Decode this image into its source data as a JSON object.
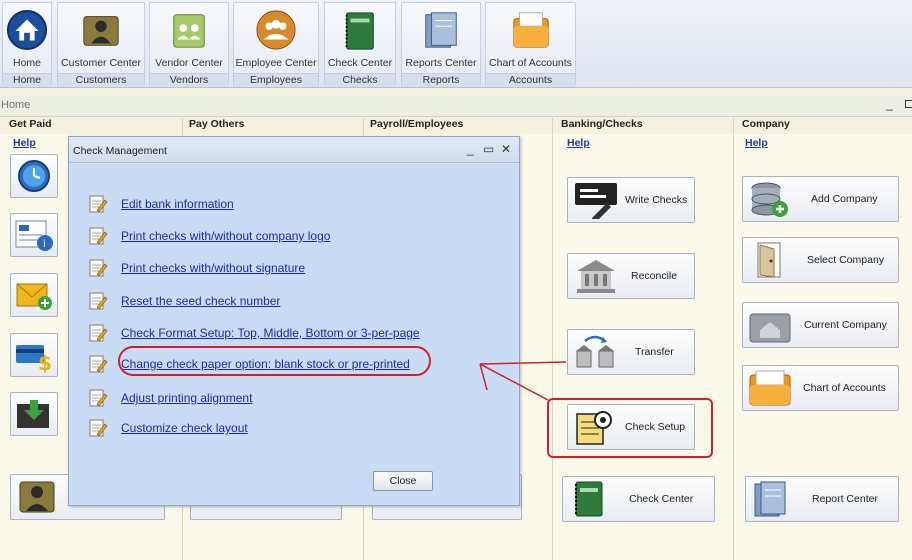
{
  "toolbar": {
    "items": [
      {
        "name": "home",
        "label": "Home",
        "group": "Home"
      },
      {
        "name": "customer-center",
        "label": "Customer Center",
        "group": "Customers"
      },
      {
        "name": "vendor-center",
        "label": "Vendor Center",
        "group": "Vendors"
      },
      {
        "name": "employee-center",
        "label": "Employee Center",
        "group": "Employees"
      },
      {
        "name": "check-center",
        "label": "Check Center",
        "group": "Checks"
      },
      {
        "name": "reports-center",
        "label": "Reports Center",
        "group": "Reports"
      },
      {
        "name": "chart-of-accounts",
        "label": "Chart of Accounts",
        "group": "Accounts"
      }
    ]
  },
  "homebar": {
    "title": "Home",
    "minimize": "_"
  },
  "columns": {
    "get_paid": "Get Paid",
    "pay_others": "Pay Others",
    "payroll": "Payroll/Employees",
    "banking": "Banking/Checks",
    "company": "Company"
  },
  "help_label": "Help",
  "banking": {
    "write_checks": "Write Checks",
    "reconcile": "Reconcile",
    "transfer": "Transfer",
    "check_setup": "Check Setup",
    "check_center": "Check Center"
  },
  "company": {
    "add_company": "Add Company",
    "select_company": "Select Company",
    "current_company": "Current Company",
    "chart_of_accounts": "Chart of Accounts",
    "report_center": "Report Center"
  },
  "dialog": {
    "title": "Check Management",
    "minimize": "_",
    "maximize": "▭",
    "close_x": "✕",
    "items": [
      "Edit bank information",
      "Print checks with/without company logo",
      "Print checks with/without signature",
      "Reset the seed check number",
      "Check Format Setup: Top, Middle, Bottom or 3-per-page",
      "Change check paper option: blank stock or pre-printed",
      "Adjust printing alignment",
      "Customize check layout"
    ],
    "close_label": "Close"
  },
  "colors": {
    "accent_red": "#d21f2a",
    "link_blue": "#1a2aa6",
    "dialog_bg": "#c8dcf6"
  }
}
